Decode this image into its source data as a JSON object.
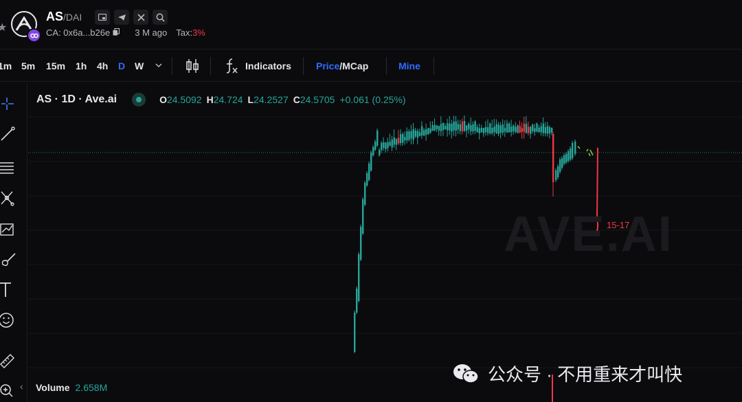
{
  "header": {
    "ticker": "AS",
    "pair": "/DAI",
    "contract": "CA: 0x6a...b26e",
    "age": "3 M ago",
    "tax_label": "Tax:",
    "tax_value": "3%"
  },
  "toolbar": {
    "timeframes": [
      "1m",
      "5m",
      "15m",
      "1h",
      "4h",
      "D",
      "W"
    ],
    "active_timeframe": "D",
    "indicators_label": "Indicators",
    "price_label": "Price",
    "mcap_label": "MCap",
    "slash": "/",
    "mine_label": "Mine"
  },
  "legend": {
    "symbol": "AS · 1D · Ave.ai",
    "open_label": "O",
    "open": "24.5092",
    "high_label": "H",
    "high": "24.724",
    "low_label": "L",
    "low": "24.2527",
    "close_label": "C",
    "close": "24.5705",
    "change": "+0.061 (0.25%)"
  },
  "watermark": "AVE.AI",
  "annotation": "15-17",
  "volume": {
    "label": "Volume",
    "value": "2.658M"
  },
  "wechat_caption": "公众号 · 不用重来才叫快",
  "colors": {
    "up": "#26a69a",
    "down": "#f23645",
    "accent": "#2f6bff",
    "background": "#0b0b0d"
  }
}
